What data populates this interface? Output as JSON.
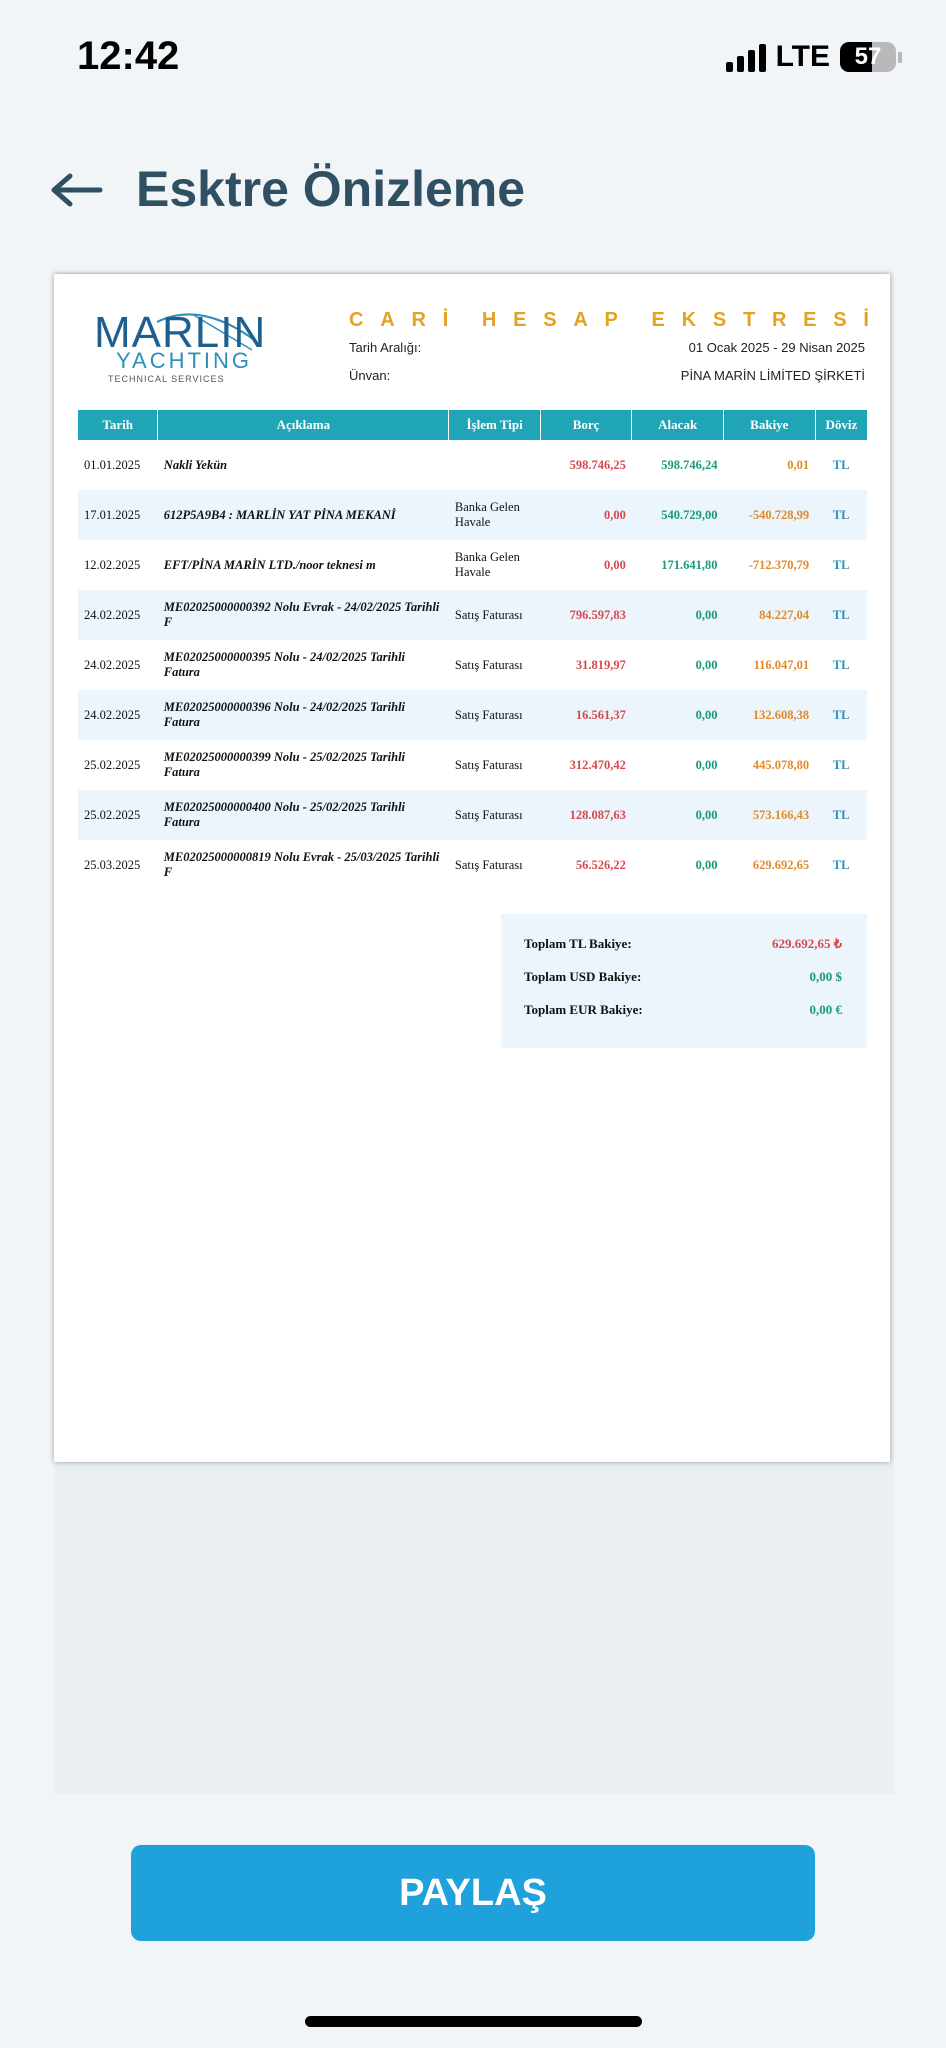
{
  "status_bar": {
    "time": "12:42",
    "network": "LTE",
    "battery": "57"
  },
  "header": {
    "title": "Esktre Önizleme"
  },
  "logo": {
    "main": "MARLIN",
    "sub": "YACHTING",
    "small": "TECHNICAL SERVICES"
  },
  "statement": {
    "title_letters": [
      "C",
      "A",
      "R",
      "İ",
      "",
      "H",
      "E",
      "S",
      "A",
      "P",
      "",
      "E",
      "K",
      "S",
      "T",
      "R",
      "E",
      "S",
      "İ"
    ],
    "date_range_label": "Tarih Aralığı:",
    "date_range_value": "01 Ocak 2025 - 29 Nisan 2025",
    "title_label": "Ünvan:",
    "title_value": "PİNA MARİN LİMİTED ŞİRKETİ",
    "columns": [
      "Tarih",
      "Açıklama",
      "İşlem Tipi",
      "Borç",
      "Alacak",
      "Bakiye",
      "Döviz"
    ],
    "rows": [
      {
        "date": "01.01.2025",
        "desc": "Nakli Yekün",
        "type": "",
        "borc": "598.746,25",
        "alacak": "598.746,24",
        "bakiye": "0,01",
        "doviz": "TL"
      },
      {
        "date": "17.01.2025",
        "desc": "612P5A9B4 : MARLİN YAT PİNA MEKANİ",
        "type": "Banka Gelen Havale",
        "borc": "0,00",
        "alacak": "540.729,00",
        "bakiye": "-540.728,99",
        "doviz": "TL"
      },
      {
        "date": "12.02.2025",
        "desc": "EFT/PİNA MARİN LTD./noor teknesi m",
        "type": "Banka Gelen Havale",
        "borc": "0,00",
        "alacak": "171.641,80",
        "bakiye": "-712.370,79",
        "doviz": "TL"
      },
      {
        "date": "24.02.2025",
        "desc": "ME02025000000392 Nolu Evrak - 24/02/2025 Tarihli F",
        "type": "Satış Faturası",
        "borc": "796.597,83",
        "alacak": "0,00",
        "bakiye": "84.227,04",
        "doviz": "TL"
      },
      {
        "date": "24.02.2025",
        "desc": "ME02025000000395 Nolu - 24/02/2025 Tarihli Fatura",
        "type": "Satış Faturası",
        "borc": "31.819,97",
        "alacak": "0,00",
        "bakiye": "116.047,01",
        "doviz": "TL"
      },
      {
        "date": "24.02.2025",
        "desc": "ME02025000000396 Nolu - 24/02/2025 Tarihli Fatura",
        "type": "Satış Faturası",
        "borc": "16.561,37",
        "alacak": "0,00",
        "bakiye": "132.608,38",
        "doviz": "TL"
      },
      {
        "date": "25.02.2025",
        "desc": "ME02025000000399 Nolu - 25/02/2025 Tarihli Fatura",
        "type": "Satış Faturası",
        "borc": "312.470,42",
        "alacak": "0,00",
        "bakiye": "445.078,80",
        "doviz": "TL"
      },
      {
        "date": "25.02.2025",
        "desc": "ME02025000000400 Nolu - 25/02/2025 Tarihli Fatura",
        "type": "Satış Faturası",
        "borc": "128.087,63",
        "alacak": "0,00",
        "bakiye": "573.166,43",
        "doviz": "TL"
      },
      {
        "date": "25.03.2025",
        "desc": "ME02025000000819 Nolu Evrak - 25/03/2025 Tarihli F",
        "type": "Satış Faturası",
        "borc": "56.526,22",
        "alacak": "0,00",
        "bakiye": "629.692,65",
        "doviz": "TL"
      }
    ],
    "totals": [
      {
        "label": "Toplam TL Bakiye:",
        "value": "629.692,65 ₺"
      },
      {
        "label": "Toplam USD Bakiye:",
        "value": "0,00 $"
      },
      {
        "label": "Toplam EUR Bakiye:",
        "value": "0,00 €"
      }
    ]
  },
  "actions": {
    "share_label": "PAYLAŞ"
  }
}
